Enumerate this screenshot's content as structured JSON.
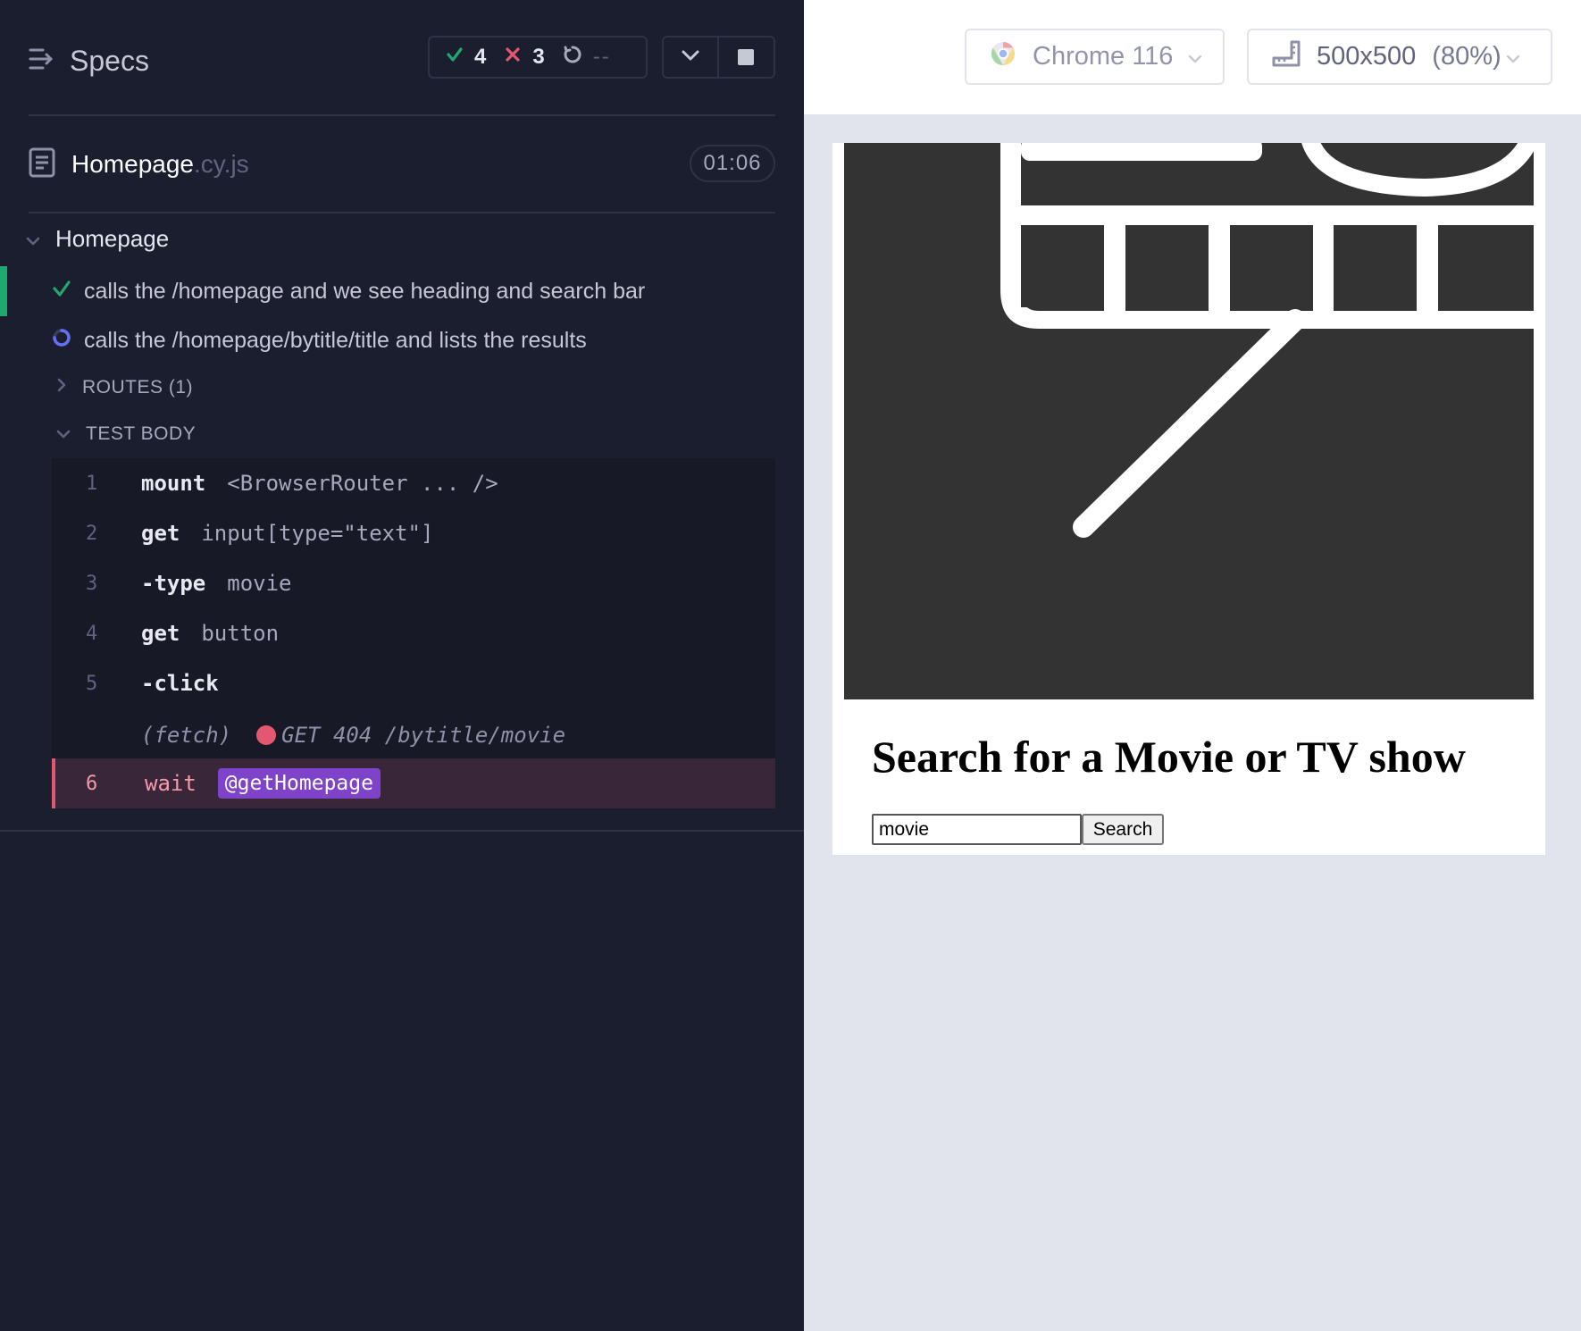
{
  "runner": {
    "specs_label": "Specs",
    "stats": {
      "passed": "4",
      "failed": "3",
      "pending": "--"
    },
    "file": {
      "name": "Homepage",
      "ext": ".cy.js",
      "duration": "01:06"
    },
    "suite_title": "Homepage",
    "tests": [
      {
        "title": "calls the /homepage and we see heading and search bar",
        "state": "passed"
      },
      {
        "title": "calls the /homepage/bytitle/title and lists the results",
        "state": "running"
      }
    ],
    "routes_label": "ROUTES (1)",
    "test_body_label": "TEST BODY",
    "commands": [
      {
        "num": "1",
        "name": "mount",
        "arg": "<BrowserRouter ... />"
      },
      {
        "num": "2",
        "name": "get",
        "arg": "input[type=\"text\"]"
      },
      {
        "num": "3",
        "name": "-type",
        "arg": "movie"
      },
      {
        "num": "4",
        "name": "get",
        "arg": "button"
      },
      {
        "num": "5",
        "name": "-click",
        "arg": ""
      },
      {
        "num": "",
        "name": "",
        "tag": "(fetch)",
        "request": "GET 404 /bytitle/movie"
      },
      {
        "num": "6",
        "name": "wait",
        "alias": "@getHomepage"
      }
    ]
  },
  "browser": {
    "name": "Chrome 116",
    "viewport": "500x500",
    "scale": "(80%)"
  },
  "app": {
    "heading": "Search for a Movie or TV show",
    "search_value": "movie",
    "search_button": "Search"
  },
  "colors": {
    "pass": "#1fa971",
    "fail": "#e45770",
    "running": "#6470f3",
    "alias": "#7f43c9"
  }
}
